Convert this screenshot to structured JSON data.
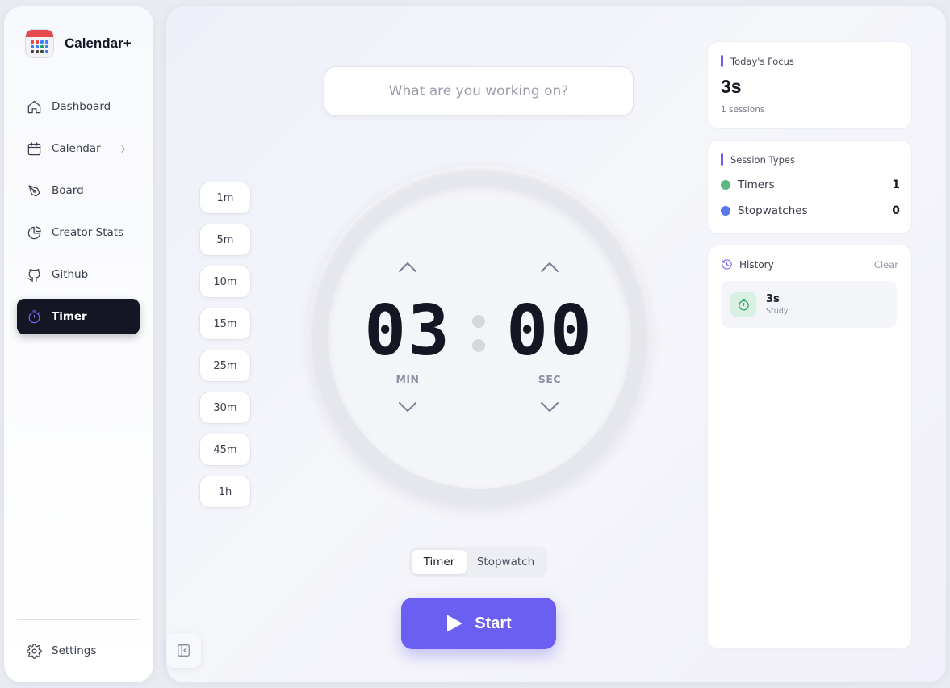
{
  "app": {
    "name": "Calendar+"
  },
  "sidebar": {
    "items": [
      {
        "label": "Dashboard",
        "icon": "home-icon"
      },
      {
        "label": "Calendar",
        "icon": "calendar-icon",
        "has_submenu": true
      },
      {
        "label": "Board",
        "icon": "pen-tool-icon"
      },
      {
        "label": "Creator Stats",
        "icon": "pie-chart-icon"
      },
      {
        "label": "Github",
        "icon": "github-icon"
      },
      {
        "label": "Timer",
        "icon": "timer-icon",
        "active": true
      }
    ],
    "settings_label": "Settings"
  },
  "task": {
    "placeholder": "What are you working on?",
    "value": ""
  },
  "presets": [
    "1m",
    "5m",
    "10m",
    "15m",
    "25m",
    "30m",
    "45m",
    "1h"
  ],
  "timer": {
    "minutes": "03",
    "seconds": "00",
    "min_label": "MIN",
    "sec_label": "SEC"
  },
  "modes": {
    "timer": "Timer",
    "stopwatch": "Stopwatch",
    "selected": "Timer"
  },
  "start_label": "Start",
  "focus_card": {
    "title": "Today's Focus",
    "value": "3s",
    "sessions": "1 sessions"
  },
  "session_types": {
    "title": "Session Types",
    "rows": [
      {
        "label": "Timers",
        "count": "1",
        "color": "#5cb87f"
      },
      {
        "label": "Stopwatches",
        "count": "0",
        "color": "#5b76e8"
      }
    ]
  },
  "history": {
    "title": "History",
    "clear_label": "Clear",
    "items": [
      {
        "value": "3s",
        "label": "Study"
      }
    ]
  },
  "colors": {
    "accent": "#6a5ff0",
    "active_nav_bg": "#141624"
  }
}
